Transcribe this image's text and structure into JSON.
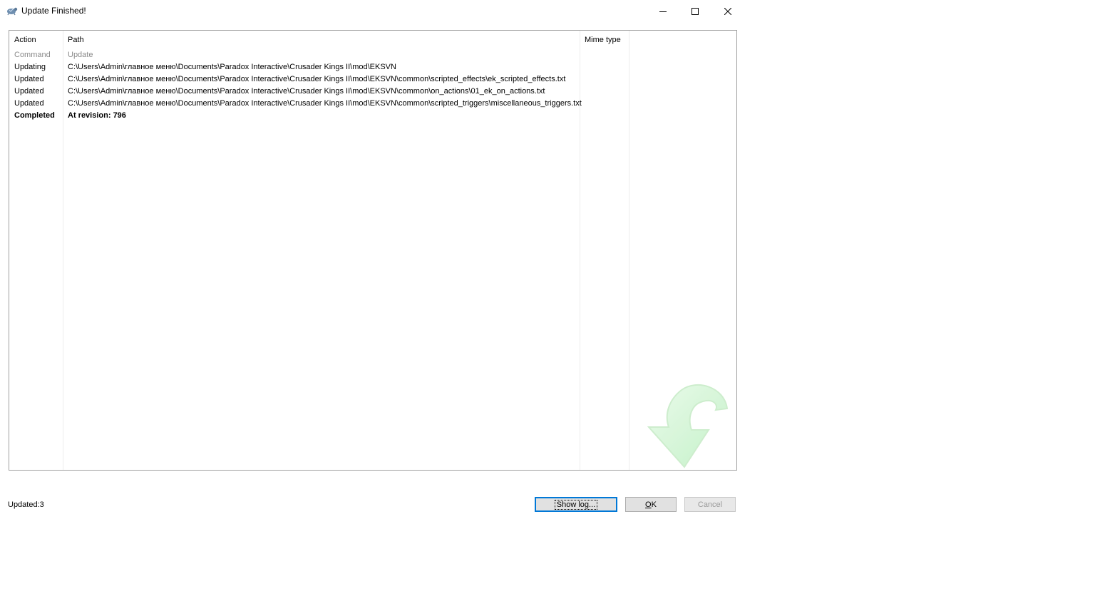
{
  "window": {
    "title": "Update Finished!",
    "icon": "tortoisesvn-icon"
  },
  "list": {
    "columns": [
      "Action",
      "Path",
      "Mime type"
    ],
    "rows": [
      {
        "action": "Command",
        "path": "Update",
        "style": "command"
      },
      {
        "action": "Updating",
        "path": "C:\\Users\\Admin\\главное меню\\Documents\\Paradox Interactive\\Crusader Kings II\\mod\\EKSVN",
        "style": "normal"
      },
      {
        "action": "Updated",
        "path": "C:\\Users\\Admin\\главное меню\\Documents\\Paradox Interactive\\Crusader Kings II\\mod\\EKSVN\\common\\scripted_effects\\ek_scripted_effects.txt",
        "style": "normal"
      },
      {
        "action": "Updated",
        "path": "C:\\Users\\Admin\\главное меню\\Documents\\Paradox Interactive\\Crusader Kings II\\mod\\EKSVN\\common\\on_actions\\01_ek_on_actions.txt",
        "style": "normal"
      },
      {
        "action": "Updated",
        "path": "C:\\Users\\Admin\\главное меню\\Documents\\Paradox Interactive\\Crusader Kings II\\mod\\EKSVN\\common\\scripted_triggers\\miscellaneous_triggers.txt",
        "style": "normal"
      },
      {
        "action": "Completed",
        "path": "At revision: 796",
        "style": "completed"
      }
    ]
  },
  "status": {
    "text": "Updated:3"
  },
  "buttons": {
    "show_log": "Show log...",
    "ok_mnemonic": "O",
    "ok_rest": "K",
    "cancel": "Cancel"
  }
}
